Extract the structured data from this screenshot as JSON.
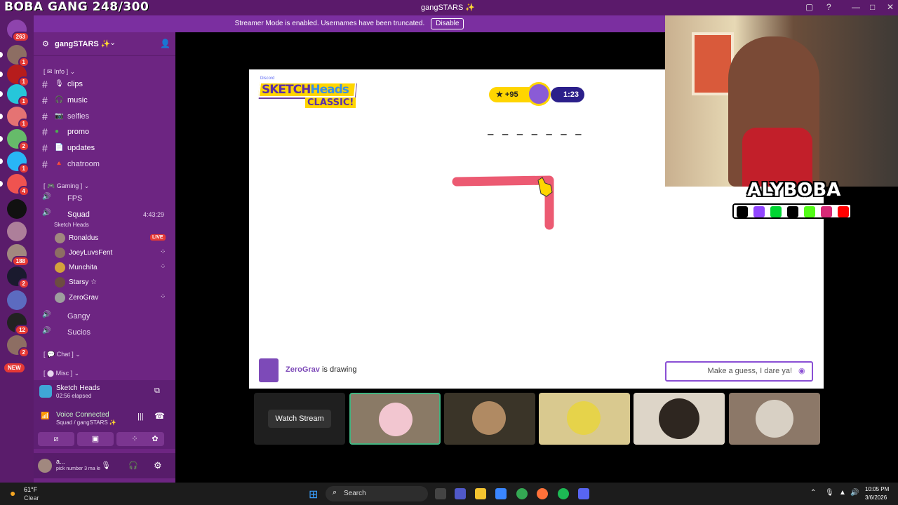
{
  "overlay_title": "BOBA GANG 248/300",
  "window": {
    "title": "gangSTARS ✨"
  },
  "banner": {
    "text": "Streamer Mode is enabled. Usernames have been truncated.",
    "button": "Disable"
  },
  "rail": {
    "home_badge": "263",
    "badges": [
      "1",
      "1",
      "1",
      "1",
      "2",
      "1",
      "4",
      "",
      "",
      "188",
      "2",
      "",
      "12",
      "2"
    ],
    "new_label": "NEW"
  },
  "server": {
    "name": "gangSTARS ✨"
  },
  "categories": {
    "info": "Info",
    "gaming": "Gaming",
    "chat": "Chat",
    "misc": "Misc"
  },
  "channels": [
    {
      "name": "clips"
    },
    {
      "name": "music"
    },
    {
      "name": "selfies"
    },
    {
      "name": "promo"
    },
    {
      "name": "updates"
    },
    {
      "name": "chatroom"
    }
  ],
  "voice_channels": [
    {
      "name": "FPS"
    },
    {
      "name": "Squad",
      "timer": "4:43:29",
      "activity": "Sketch Heads"
    },
    {
      "name": "Gangy"
    },
    {
      "name": "Sucios"
    }
  ],
  "members": [
    {
      "name": "Ronaldus",
      "live": "LIVE"
    },
    {
      "name": "JoeyLuvsFent"
    },
    {
      "name": "Munchita"
    },
    {
      "name": "Starsy ☆"
    },
    {
      "name": "ZeroGrav"
    }
  ],
  "activity": {
    "name": "Sketch Heads",
    "elapsed": "02:56 elapsed"
  },
  "voice": {
    "status": "Voice Connected",
    "location": "Squad / gangSTARS ✨"
  },
  "user": {
    "name": "a...",
    "status": "pick number 3 ma le"
  },
  "game": {
    "logo_top": "Discord",
    "logo_main": "SKETCH",
    "logo_main2": "Heads",
    "logo_sub": "CLASSIC!",
    "score": "+95",
    "timer": "1:23",
    "word_blanks": "_ _ _ _ _ _ _",
    "drawer": "ZeroGrav",
    "drawing_text": " is drawing",
    "guess_placeholder": "Make a guess, I dare ya!"
  },
  "cam": {
    "brand": "ALYBOBA"
  },
  "tiles": {
    "watch_stream": "Watch Stream"
  },
  "taskbar": {
    "weather_temp": "61°F",
    "weather_desc": "Clear",
    "search": "Search",
    "time": "10:05 PM",
    "date": "3/6/2026"
  },
  "colors": {
    "accent": "#8a4fd4",
    "sidebar": "#6d2582",
    "rail": "#5a1c6b",
    "live": "#e53935"
  }
}
